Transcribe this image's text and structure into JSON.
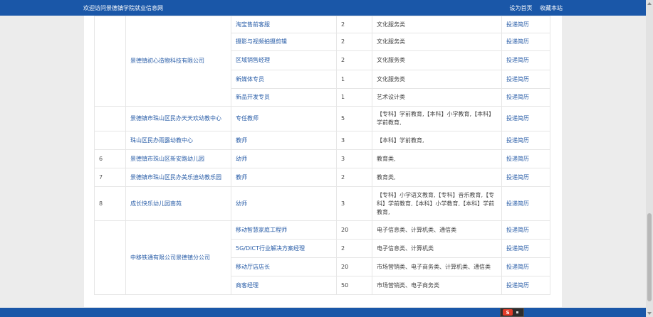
{
  "header": {
    "welcome": "欢迎访问景德镇学院就业信息网",
    "set_homepage": "设为首页",
    "bookmark": "收藏本站"
  },
  "apply_label": "投递简历",
  "groups": [
    {
      "number": "",
      "company": "景德镇初心造物科技有限公司",
      "rows": [
        {
          "position": "淘宝售前客服",
          "count": "2",
          "major": "文化服务类"
        },
        {
          "position": "摄影与视频拍摄剪辑",
          "count": "2",
          "major": "文化服务类"
        },
        {
          "position": "区域销售经理",
          "count": "2",
          "major": "文化服务类"
        },
        {
          "position": "新媒体专员",
          "count": "1",
          "major": "文化服务类"
        },
        {
          "position": "新品开发专员",
          "count": "1",
          "major": "艺术设计类"
        }
      ]
    },
    {
      "number": "",
      "company": "景德镇市珠山区民办天天欢幼教中心",
      "rows": [
        {
          "position": "专任教师",
          "count": "5",
          "major": "【专科】学前教育,【本科】小学教育,【本科】学前教育,"
        }
      ]
    },
    {
      "number": "",
      "company": "珠山区民办雨露幼教中心",
      "rows": [
        {
          "position": "教师",
          "count": "3",
          "major": "【本科】学前教育,"
        }
      ]
    },
    {
      "number": "6",
      "company": "景德镇市珠山区新安路幼儿园",
      "rows": [
        {
          "position": "幼师",
          "count": "3",
          "major": "教育类,"
        }
      ]
    },
    {
      "number": "7",
      "company": "景德镇市珠山区民办美乐迪幼教乐园",
      "rows": [
        {
          "position": "教师",
          "count": "2",
          "major": "教育类,"
        }
      ]
    },
    {
      "number": "8",
      "company": "成长快乐幼儿园南苑",
      "rows": [
        {
          "position": "幼师",
          "count": "3",
          "major": "【专科】小学语文教育,【专科】音乐教育,【专科】学前教育,【本科】小学教育,【本科】学前教育,"
        }
      ]
    },
    {
      "number": "",
      "company": "中移铁通有限公司景德镇分公司",
      "rows": [
        {
          "position": "移动智慧家庭工程师",
          "count": "20",
          "major": "电子信息类、计算机类、通信类"
        },
        {
          "position": "5G/DICT行业解决方案经理",
          "count": "2",
          "major": "电子信息类、计算机类"
        },
        {
          "position": "移动厅店店长",
          "count": "20",
          "major": "市场营销类、电子商务类、计算机类、通信类"
        },
        {
          "position": "商客经理",
          "count": "50",
          "major": "市场营销类、电子商务类"
        }
      ]
    }
  ],
  "ime_badge_text": "S"
}
